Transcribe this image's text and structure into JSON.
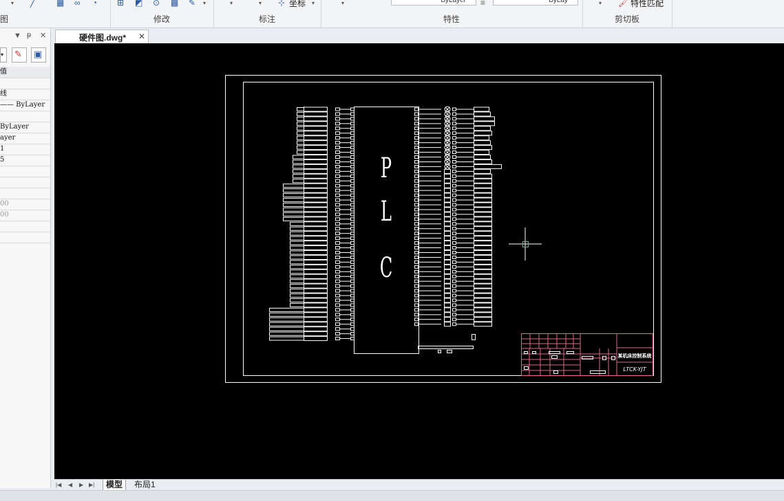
{
  "ribbon": {
    "groups": [
      {
        "label": "图"
      },
      {
        "label": "修改"
      },
      {
        "label": "标注"
      },
      {
        "label": "特性"
      },
      {
        "label": "剪切板"
      }
    ],
    "coord_label": "坐标",
    "linetype_value": "ByLayer",
    "lineweight_value": "ByLay",
    "match_props_label": "特性匹配"
  },
  "palette": {
    "title_buttons": [
      "▼",
      "ᵽ",
      "✕"
    ],
    "rows": [
      {
        "text": "值",
        "gray": false
      },
      {
        "text": "",
        "gray": false
      },
      {
        "text": "线",
        "gray": false
      },
      {
        "text": "—— ByLayer",
        "gray": false
      },
      {
        "text": "",
        "gray": false
      },
      {
        "text": "ByLayer",
        "gray": false
      },
      {
        "text": "ayer",
        "gray": false
      },
      {
        "text": "1",
        "gray": false
      },
      {
        "text": "5",
        "gray": false
      },
      {
        "text": "",
        "gray": false
      },
      {
        "text": "",
        "gray": false
      },
      {
        "text": "",
        "gray": false
      },
      {
        "text": "00",
        "gray": true
      },
      {
        "text": "00",
        "gray": true
      },
      {
        "text": "",
        "gray": false
      },
      {
        "text": "",
        "gray": false
      }
    ]
  },
  "document_tab": {
    "title": "硬件图.dwg*",
    "close": "✕"
  },
  "drawing": {
    "plc_letters": [
      "P",
      "L",
      "C"
    ],
    "title_block_name": "某机床控制系统",
    "drawing_code": "LTCK-YJT"
  },
  "layout_tabs": [
    {
      "label": "模型",
      "active": true
    },
    {
      "label": "布局1",
      "active": false
    }
  ],
  "nav_arrows": [
    "|◀",
    "◀",
    "▶",
    "▶|"
  ]
}
